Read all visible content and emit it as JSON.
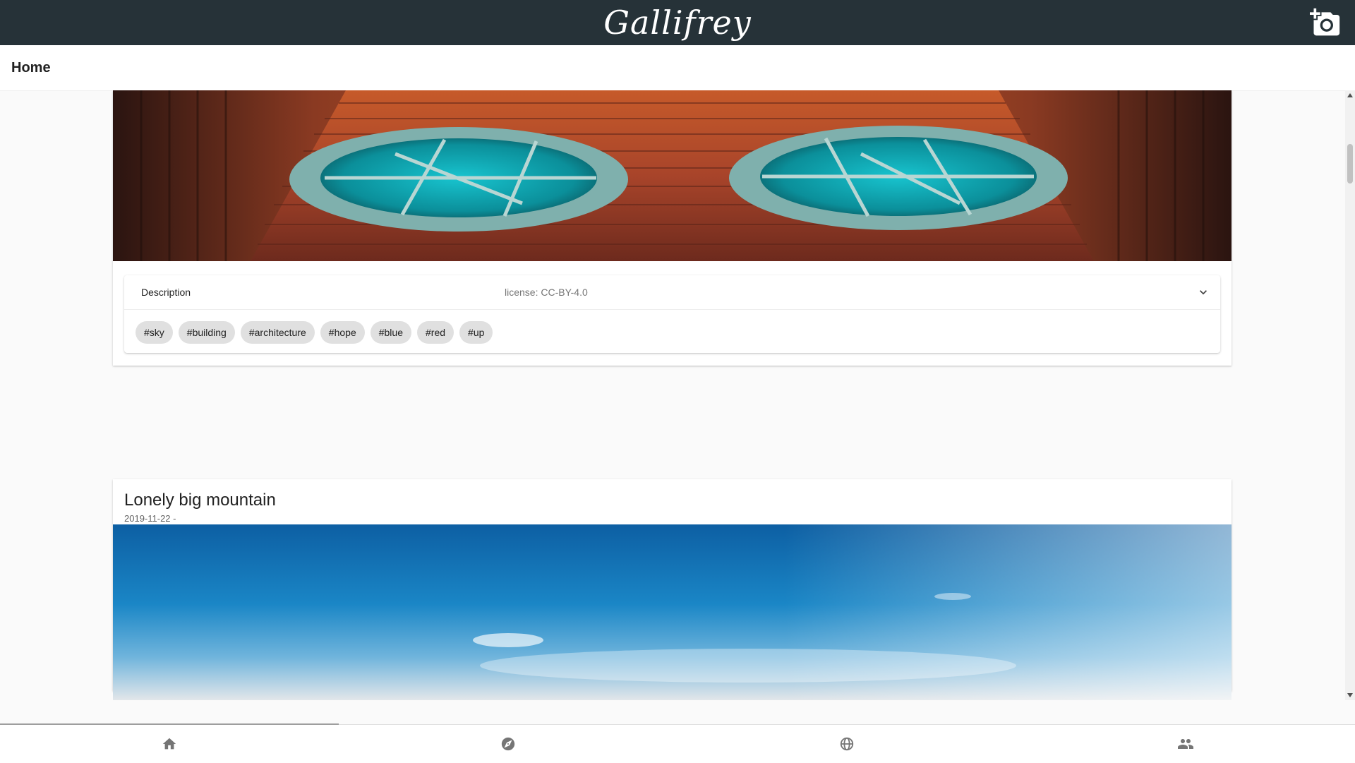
{
  "header": {
    "brand": "Gallifrey",
    "add_photo_icon": "add-a-photo-icon"
  },
  "subheader": {
    "title": "Home"
  },
  "posts": [
    {
      "image_icon": "round-windows-photo",
      "description": {
        "label": "Description",
        "license": "license: CC-BY-4.0",
        "expand_icon": "chevron-down-icon"
      },
      "tags": [
        "#sky",
        "#building",
        "#architecture",
        "#hope",
        "#blue",
        "#red",
        "#up"
      ]
    },
    {
      "title": "Lonely big mountain",
      "date": "2019-11-22 -",
      "image_icon": "blue-sky-photo"
    }
  ],
  "bottom_nav": [
    {
      "icon": "home-icon"
    },
    {
      "icon": "explore-icon"
    },
    {
      "icon": "globe-icon"
    },
    {
      "icon": "people-icon"
    }
  ],
  "colors": {
    "topbar": "#263238",
    "chip": "#e0e0e0",
    "icon": "#757575"
  }
}
